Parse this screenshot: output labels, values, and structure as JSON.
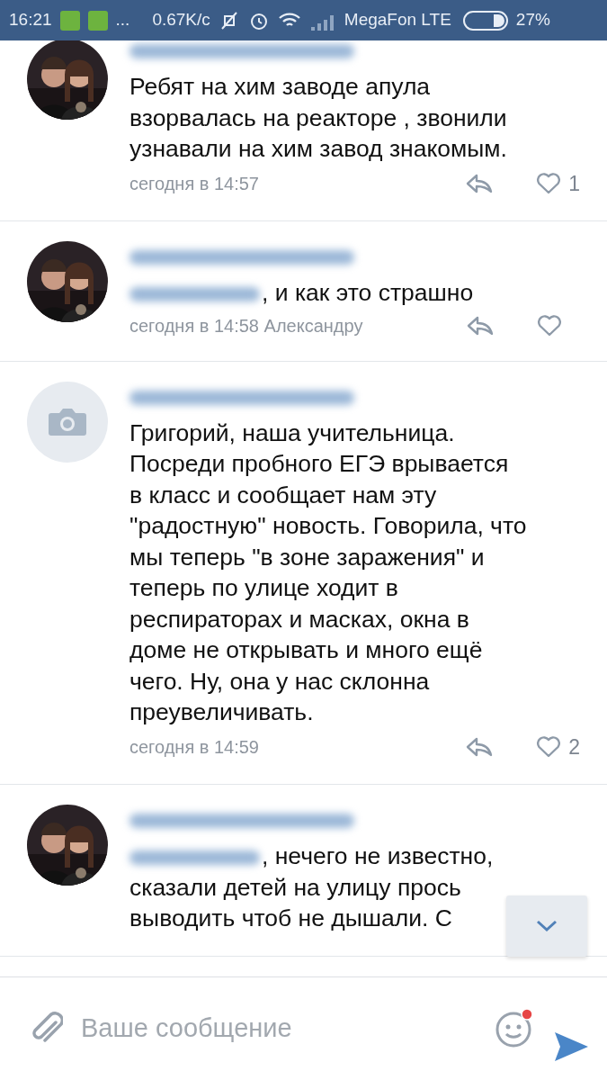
{
  "status_bar": {
    "time": "16:21",
    "more": "...",
    "speed": "0.67K/c",
    "carrier": "MegaFon LTE",
    "battery": "27%"
  },
  "comments": [
    {
      "mention": false,
      "text": "Ребят на хим заводе апула\nвзорвалась на реакторе , звонили\nузнавали на хим завод знакомым.",
      "time": "сегодня в 14:57",
      "likes": "1"
    },
    {
      "mention": true,
      "text": ", и как это страшно",
      "time": "сегодня в 14:58 Александру"
    },
    {
      "kind": "placeholder",
      "mention": false,
      "text": "Григорий, наша учительница.\nПосреди пробного ЕГЭ врывается\nв класс и сообщает нам эту\n\"радостную\" новость. Говорила, что\nмы теперь \"в зоне заражения\" и\nтеперь по улице ходит в\nреспираторах и масках, окна в\nдоме не открывать и много ещё\nчего. Ну, она у нас склонна\nпреувеличивать.",
      "time": "сегодня в 14:59",
      "likes": "2"
    },
    {
      "mention": true,
      "text": ", нечего не известно,\nсказали детей на улицу прось\nвыводить чтоб не дышали. С"
    }
  ],
  "composer": {
    "placeholder": "Ваше сообщение",
    "emoji_badge": true
  }
}
